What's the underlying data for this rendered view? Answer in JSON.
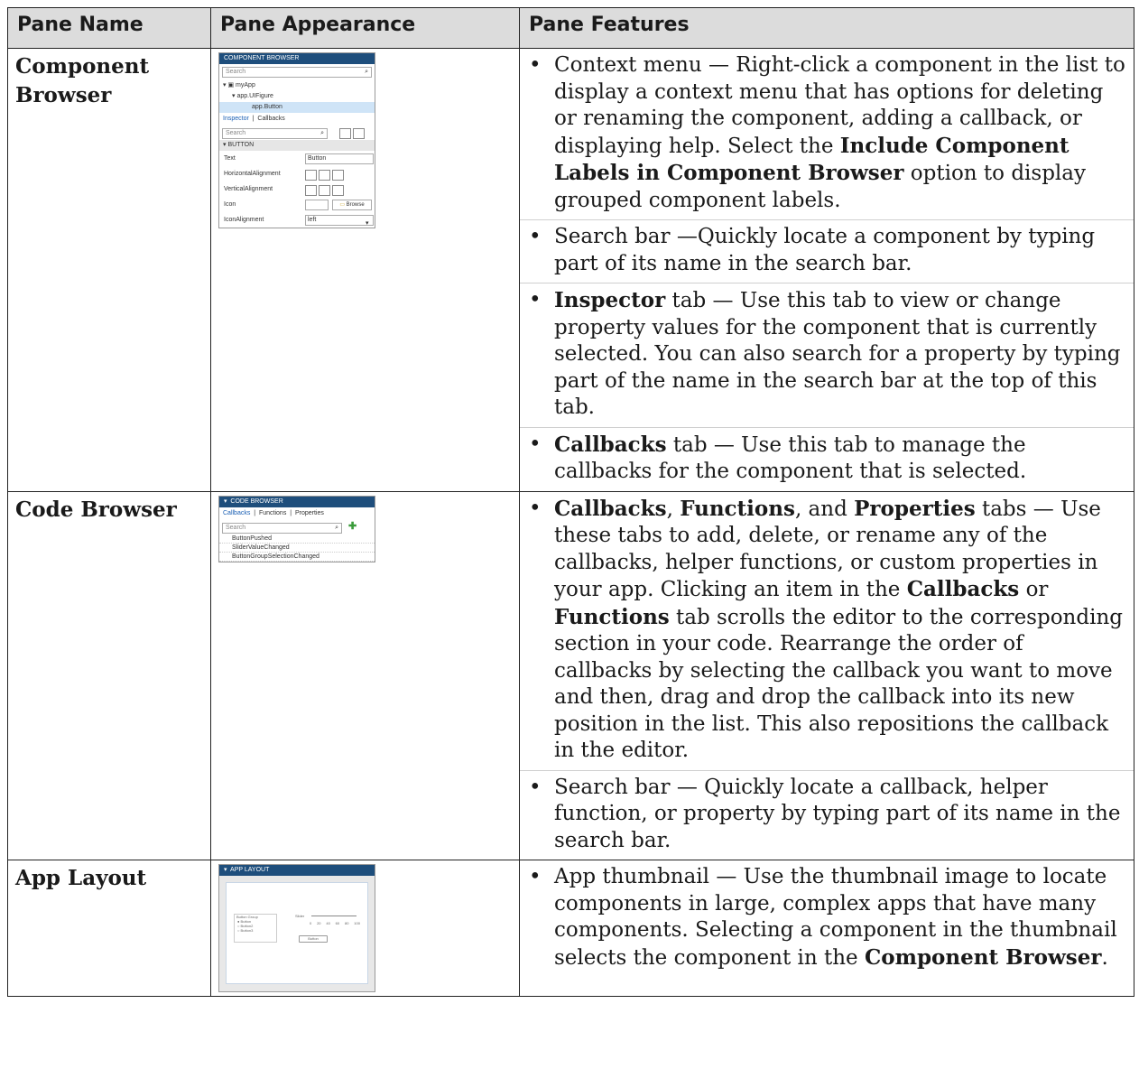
{
  "headers": [
    "Pane Name",
    "Pane Appearance",
    "Pane Features"
  ],
  "rows": [
    {
      "name_lines": [
        "Component",
        "Browser"
      ],
      "thumb": {
        "title": "COMPONENT BROWSER",
        "search": "Search",
        "tree": [
          "myApp",
          "app.UIFigure",
          "app.Button"
        ],
        "tabs": [
          "Inspector",
          "Callbacks"
        ],
        "search2": "Search",
        "section": "BUTTON",
        "props": [
          {
            "label": "Text",
            "value": "Button"
          },
          {
            "label": "HorizontalAlignment",
            "value": ""
          },
          {
            "label": "VerticalAlignment",
            "value": ""
          },
          {
            "label": "Icon",
            "value": "Browse"
          },
          {
            "label": "IconAlignment",
            "value": "left"
          }
        ]
      },
      "features": [
        {
          "parts": [
            {
              "t": "Context menu — Right-click a component in the list to display a context menu that has options for deleting or renaming the component, adding a callback, or displaying help. Select the ",
              "b": false
            },
            {
              "t": "Include Component Labels in Component Browser",
              "b": true
            },
            {
              "t": " option to display grouped component labels.",
              "b": false
            }
          ]
        },
        {
          "parts": [
            {
              "t": "Search bar —Quickly locate a component by typing part of its name in the search bar.",
              "b": false
            }
          ]
        },
        {
          "parts": [
            {
              "t": "Inspector",
              "b": true
            },
            {
              "t": " tab — Use this tab to view or change property values for the component that is currently selected. You can also search for a property by typing part of the name in the search bar at the top of this tab.",
              "b": false
            }
          ]
        },
        {
          "parts": [
            {
              "t": "Callbacks",
              "b": true
            },
            {
              "t": " tab — Use this tab to manage the callbacks for the component that is selected.",
              "b": false
            }
          ]
        }
      ]
    },
    {
      "name_lines": [
        "Code Browser"
      ],
      "thumb": {
        "title": "CODE BROWSER",
        "tabs": [
          "Callbacks",
          "Functions",
          "Properties"
        ],
        "search": "Search",
        "items": [
          "ButtonPushed",
          "SliderValueChanged",
          "ButtonGroupSelectionChanged"
        ]
      },
      "features": [
        {
          "parts": [
            {
              "t": "Callbacks",
              "b": true
            },
            {
              "t": ", ",
              "b": false
            },
            {
              "t": "Functions",
              "b": true
            },
            {
              "t": ", and ",
              "b": false
            },
            {
              "t": "Properties",
              "b": true
            },
            {
              "t": " tabs — Use these tabs to add, delete, or rename any of the callbacks, helper functions, or custom properties in your app. Clicking an item in the ",
              "b": false
            },
            {
              "t": "Callbacks",
              "b": true
            },
            {
              "t": " or ",
              "b": false
            },
            {
              "t": "Functions",
              "b": true
            },
            {
              "t": " tab scrolls the editor to the corresponding section in your code. Rearrange the order of callbacks by selecting the callback you want to move and then, drag and drop the callback into its new position in the list. This also repositions the callback in the editor.",
              "b": false
            }
          ]
        },
        {
          "parts": [
            {
              "t": "Search bar — Quickly locate a callback, helper function, or property by typing part of its name in the search bar.",
              "b": false
            }
          ]
        }
      ]
    },
    {
      "name_lines": [
        "App Layout"
      ],
      "thumb": {
        "title": "APP LAYOUT",
        "group": "Button Group",
        "radios": [
          "Button",
          "Button2",
          "Button3"
        ],
        "slider_label": "Slider",
        "ticks": [
          "0",
          "20",
          "40",
          "60",
          "80",
          "100"
        ],
        "button": "Button"
      },
      "features": [
        {
          "parts": [
            {
              "t": "App thumbnail — Use the thumbnail image to locate components in large, complex apps that have many components. Selecting a component in the thumbnail selects the component in the ",
              "b": false
            },
            {
              "t": "Component Browser",
              "b": true
            },
            {
              "t": ".",
              "b": false
            }
          ]
        }
      ]
    }
  ]
}
